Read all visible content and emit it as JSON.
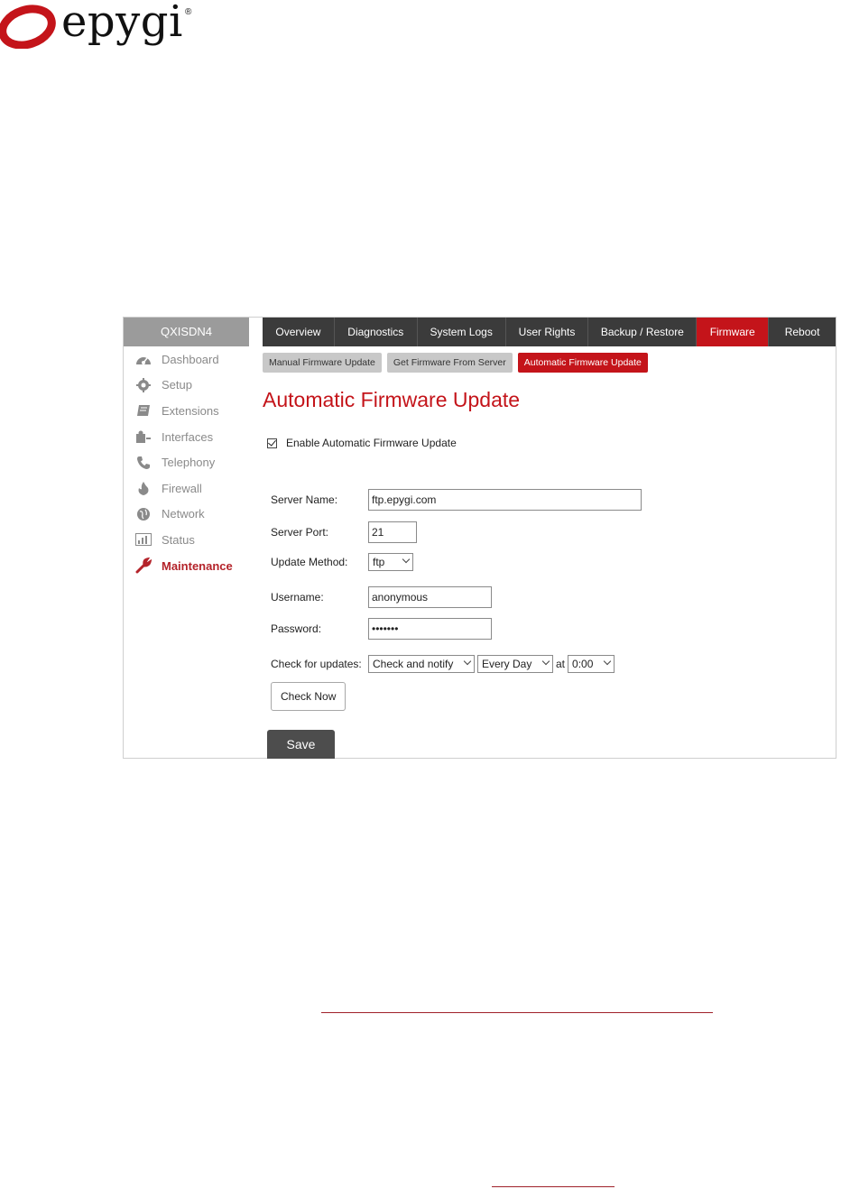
{
  "logo": {
    "text": "epygi",
    "reg": "®"
  },
  "sidebar": {
    "device_name": "QXISDN4",
    "items": [
      {
        "label": "Dashboard",
        "icon": "dashboard-icon"
      },
      {
        "label": "Setup",
        "icon": "gear-icon"
      },
      {
        "label": "Extensions",
        "icon": "book-icon"
      },
      {
        "label": "Interfaces",
        "icon": "puzzle-icon"
      },
      {
        "label": "Telephony",
        "icon": "phone-icon"
      },
      {
        "label": "Firewall",
        "icon": "flame-icon"
      },
      {
        "label": "Network",
        "icon": "globe-icon"
      },
      {
        "label": "Status",
        "icon": "bar-chart-icon"
      },
      {
        "label": "Maintenance",
        "icon": "wrench-icon",
        "active": true
      }
    ]
  },
  "tabs": [
    {
      "label": "Overview"
    },
    {
      "label": "Diagnostics"
    },
    {
      "label": "System Logs"
    },
    {
      "label": "User Rights"
    },
    {
      "label": "Backup / Restore"
    },
    {
      "label": "Firmware",
      "active": true
    },
    {
      "label": "Reboot"
    }
  ],
  "subtabs": [
    {
      "label": "Manual Firmware Update"
    },
    {
      "label": "Get Firmware From Server"
    },
    {
      "label": "Automatic Firmware Update",
      "active": true
    }
  ],
  "page": {
    "title": "Automatic Firmware Update",
    "enable_label": "Enable Automatic Firmware Update",
    "enable_checked": true
  },
  "form": {
    "server_name_label": "Server Name:",
    "server_name_value": "ftp.epygi.com",
    "server_port_label": "Server Port:",
    "server_port_value": "21",
    "update_method_label": "Update Method:",
    "update_method_value": "ftp",
    "username_label": "Username:",
    "username_value": "anonymous",
    "password_label": "Password:",
    "password_value": "•••••••",
    "check_label": "Check for updates:",
    "check_mode_value": "Check and notify",
    "check_frequency_value": "Every Day",
    "at_label": "at",
    "check_time_value": "0:00",
    "check_now_label": "Check Now",
    "save_label": "Save"
  },
  "colors": {
    "accent": "#c4141a",
    "tabbar": "#3b3b3b",
    "sidebar_header": "#9b9b9b"
  }
}
